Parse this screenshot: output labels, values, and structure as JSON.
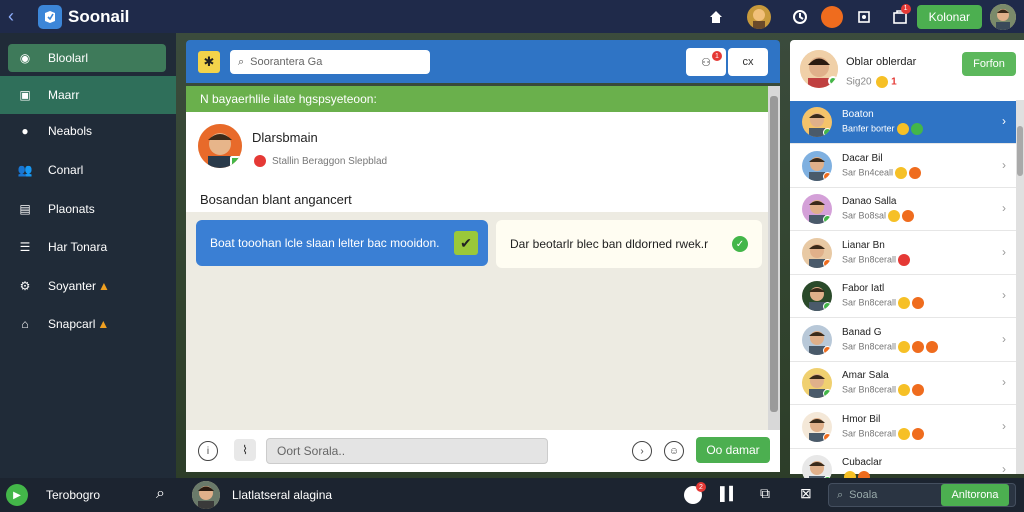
{
  "app": {
    "title": "Soonail"
  },
  "topbar": {
    "button_label": "Kolonar",
    "notif_badge": "1"
  },
  "sidebar": {
    "items": [
      {
        "label": "Bloolarl",
        "icon": "compass-icon"
      },
      {
        "label": "Maarr",
        "icon": "bookmark-icon"
      },
      {
        "label": "Neabols",
        "icon": "circle-icon"
      },
      {
        "label": "Conarl",
        "icon": "users-icon"
      },
      {
        "label": "Plaonats",
        "icon": "document-icon"
      },
      {
        "label": "Har Tonara",
        "icon": "list-icon"
      },
      {
        "label": "Soyanter",
        "icon": "settings-icon"
      },
      {
        "label": "Snapcarl",
        "icon": "lock-icon"
      }
    ]
  },
  "center": {
    "search_placeholder": "Soorantera Ga",
    "header_btn_label": "cx",
    "header_badge": "1",
    "banner": "N bayaerhlile ilate hgspsyeteoon:",
    "post": {
      "author": "Dlarsbmain",
      "meta": "Stallin Beraggon Slepblad",
      "body": "Bosandan blant angancert"
    },
    "bubbles": [
      {
        "text": "Boat tooohan lcle slaan lelter bac mooidon."
      },
      {
        "text": "Dar beotarlr blec ban dldorned rwek.r"
      }
    ],
    "compose_placeholder": "Oort Sorala..",
    "send_label": "Oo damar"
  },
  "right": {
    "profile_name": "Oblar oblerdar",
    "profile_sub": "Sig20",
    "profile_badge": "1",
    "follow_label": "Forfon",
    "contacts": [
      {
        "name": "Boaton",
        "sub": "Banfer borter",
        "active": true,
        "emojis": [
          "y",
          "g"
        ]
      },
      {
        "name": "Dacar Bil",
        "sub": "Sar Bn4ceall",
        "active": false,
        "emojis": [
          "y",
          "o"
        ]
      },
      {
        "name": "Danao Salla",
        "sub": "Sar Bo8sal",
        "active": false,
        "emojis": [
          "y",
          "o"
        ]
      },
      {
        "name": "Lianar Bn",
        "sub": "Sar Bn8cerall",
        "active": false,
        "emojis": [
          "r"
        ]
      },
      {
        "name": "Fabor Iatl",
        "sub": "Sar Bn8cerall",
        "active": false,
        "emojis": [
          "y",
          "o"
        ]
      },
      {
        "name": "Banad G",
        "sub": "Sar Bn8cerall",
        "active": false,
        "emojis": [
          "y",
          "o",
          "o"
        ]
      },
      {
        "name": "Amar Sala",
        "sub": "Sar Bn8cerall",
        "active": false,
        "emojis": [
          "y",
          "o"
        ]
      },
      {
        "name": "Hmor Bil",
        "sub": "Sar Bn8cerall",
        "active": false,
        "emojis": [
          "y",
          "o"
        ]
      },
      {
        "name": "Cubaclar",
        "sub": "",
        "active": false,
        "emojis": [
          "y",
          "o"
        ]
      }
    ]
  },
  "bottombar": {
    "left_label": "Terobogro",
    "user_label": "Llatlatseral alagina",
    "badge": "2",
    "search_placeholder": "Soala",
    "button_label": "Anltorona"
  }
}
